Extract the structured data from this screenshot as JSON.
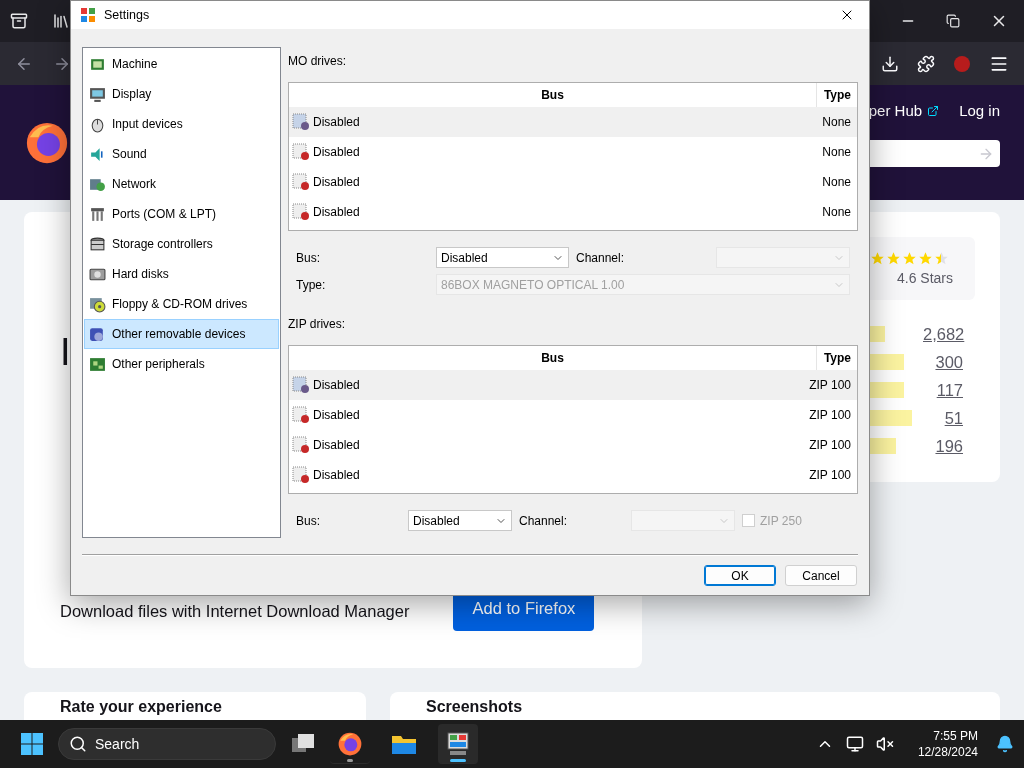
{
  "browser": {
    "header": {
      "links": [
        {
          "label": "per Hub",
          "external": true
        },
        {
          "label": "Log in",
          "external": false
        }
      ]
    },
    "card": {
      "heading_lines": [
        "I"
      ],
      "description": "Download files with Internet Download Manager",
      "button": "Add to Firefox"
    },
    "rating": {
      "stars": 4.5,
      "caption": "4.6 Stars",
      "bars": [
        {
          "level": 0.45,
          "count": "2,682"
        },
        {
          "level": 0.8,
          "count": "300"
        },
        {
          "level": 0.8,
          "count": "117"
        },
        {
          "level": 0.95,
          "count": "51"
        },
        {
          "level": 0.65,
          "count": "196"
        }
      ]
    },
    "sections": [
      "Rate your experience",
      "Screenshots"
    ]
  },
  "dialog": {
    "title": "Settings",
    "sidebar": [
      {
        "label": "Machine",
        "selected": false
      },
      {
        "label": "Display",
        "selected": false
      },
      {
        "label": "Input devices",
        "selected": false
      },
      {
        "label": "Sound",
        "selected": false
      },
      {
        "label": "Network",
        "selected": false
      },
      {
        "label": "Ports (COM & LPT)",
        "selected": false
      },
      {
        "label": "Storage controllers",
        "selected": false
      },
      {
        "label": "Hard disks",
        "selected": false
      },
      {
        "label": "Floppy & CD-ROM drives",
        "selected": false
      },
      {
        "label": "Other removable devices",
        "selected": true
      },
      {
        "label": "Other peripherals",
        "selected": false
      }
    ],
    "mo_drives": {
      "label": "MO drives:",
      "columns": [
        "Bus",
        "Type"
      ],
      "rows": [
        {
          "bus": "Disabled",
          "type": "None",
          "selected": true
        },
        {
          "bus": "Disabled",
          "type": "None",
          "selected": false
        },
        {
          "bus": "Disabled",
          "type": "None",
          "selected": false
        },
        {
          "bus": "Disabled",
          "type": "None",
          "selected": false
        }
      ],
      "bus": {
        "label": "Bus:",
        "value": "Disabled",
        "disabled": false
      },
      "channel": {
        "label": "Channel:",
        "disabled": true
      },
      "type": {
        "label": "Type:",
        "value": "86BOX MAGNETO OPTICAL 1.00",
        "disabled": true
      }
    },
    "zip_drives": {
      "label": "ZIP drives:",
      "columns": [
        "Bus",
        "Type"
      ],
      "rows": [
        {
          "bus": "Disabled",
          "type": "ZIP 100",
          "selected": true
        },
        {
          "bus": "Disabled",
          "type": "ZIP 100",
          "selected": false
        },
        {
          "bus": "Disabled",
          "type": "ZIP 100",
          "selected": false
        },
        {
          "bus": "Disabled",
          "type": "ZIP 100",
          "selected": false
        }
      ],
      "bus": {
        "label": "Bus:",
        "value": "Disabled",
        "disabled": false
      },
      "channel": {
        "label": "Channel:",
        "disabled": true
      },
      "zip250": {
        "label": "ZIP 250",
        "checked": false,
        "disabled": true
      }
    },
    "buttons": [
      {
        "label": "OK",
        "default": true
      },
      {
        "label": "Cancel",
        "default": false
      }
    ]
  },
  "taskbar": {
    "search": "Search",
    "apps": [
      {
        "running": true,
        "active": false
      },
      {
        "running": false,
        "active": false
      },
      {
        "running": true,
        "active": true
      }
    ],
    "time": "7:55 PM",
    "date": "12/28/2024"
  }
}
